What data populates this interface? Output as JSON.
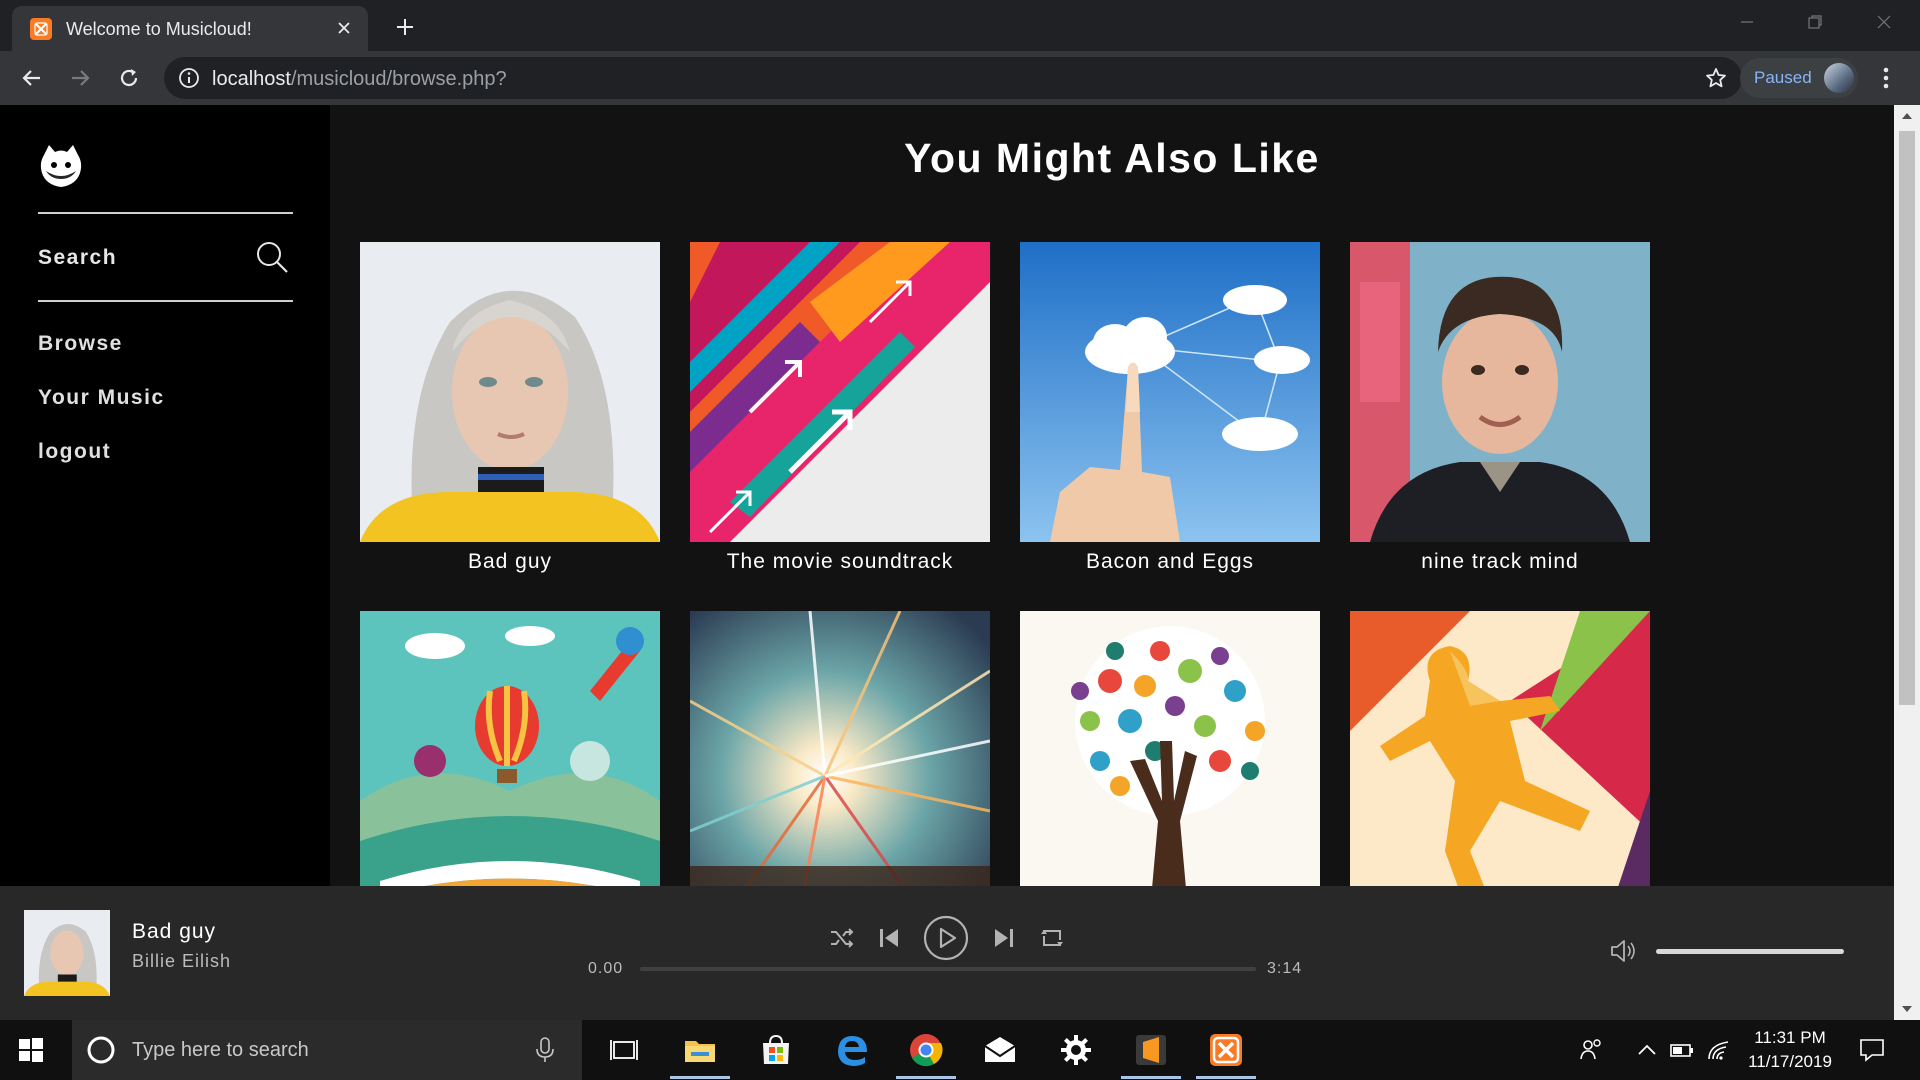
{
  "browser": {
    "tab_title": "Welcome to Musicloud!",
    "url_host": "localhost",
    "url_path": "/musicloud/browse.php?",
    "profile_status": "Paused"
  },
  "sidebar": {
    "search_label": "Search",
    "items": [
      {
        "label": "Browse"
      },
      {
        "label": "Your Music"
      },
      {
        "label": "logout"
      }
    ]
  },
  "main": {
    "heading": "You Might Also Like",
    "albums": [
      {
        "title": "Bad guy",
        "art": "portrait-blonde"
      },
      {
        "title": "The movie soundtrack",
        "art": "colorful-arrows"
      },
      {
        "title": "Bacon and Eggs",
        "art": "cloud-hand"
      },
      {
        "title": "nine track mind",
        "art": "portrait-man"
      },
      {
        "title": "",
        "art": "book-balloon"
      },
      {
        "title": "",
        "art": "light-burst"
      },
      {
        "title": "",
        "art": "hand-tree"
      },
      {
        "title": "",
        "art": "running-figure"
      }
    ]
  },
  "player": {
    "track_title": "Bad guy",
    "artist": "Billie Eilish",
    "elapsed": "0.00",
    "duration": "3:14",
    "progress_fraction": 0.0,
    "volume_fraction": 1.0
  },
  "taskbar": {
    "search_placeholder": "Type here to search",
    "time": "11:31 PM",
    "date": "11/17/2019"
  },
  "colors": {
    "sidebar_bg": "#000000",
    "main_bg": "#121212",
    "player_bg": "#282828",
    "chrome_dark": "#202124",
    "chrome_toolbar": "#35363a",
    "xampp_orange": "#fb7a24",
    "paused_blue": "#8ab4f8"
  }
}
